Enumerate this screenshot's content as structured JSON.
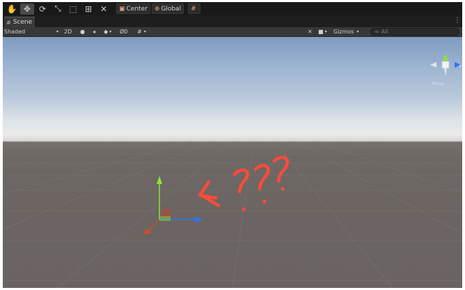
{
  "toolbar": {
    "tools": [
      {
        "name": "hand-tool",
        "icon": "hand-icon",
        "glyph": "✋",
        "active": false
      },
      {
        "name": "move-tool",
        "icon": "move-icon",
        "glyph": "✥",
        "active": true
      },
      {
        "name": "rotate-tool",
        "icon": "rotate-icon",
        "glyph": "⟳",
        "active": false
      },
      {
        "name": "scale-tool",
        "icon": "scale-icon",
        "glyph": "⤡",
        "active": false
      },
      {
        "name": "rect-tool",
        "icon": "rect-tool-icon",
        "glyph": "⬚",
        "active": false
      },
      {
        "name": "transform-tool",
        "icon": "transform-icon",
        "glyph": "⊞",
        "active": false
      },
      {
        "name": "custom-tool",
        "icon": "custom-tool-icon",
        "glyph": "✕",
        "active": false
      }
    ],
    "pivot_label": "Center",
    "space_label": "Global",
    "pivot_icon": "▣",
    "space_icon": "⊕",
    "snap_icon": "#"
  },
  "tab": {
    "label": "Scene",
    "icon": "#",
    "menu": "⋮"
  },
  "scene_bar": {
    "shading": "Shaded",
    "mode_2d": "2D",
    "light_icon": "●",
    "audio_icon": "◂",
    "fx_icon": "◆",
    "hidden_icon": "Ø",
    "hidden_count": "0",
    "grid_icon": "#",
    "tools_icon": "✕",
    "camera_icon": "■",
    "gizmos": "Gizmos",
    "search_placeholder": "All",
    "search_icon": "≈",
    "dropdown_glyph": "▾"
  },
  "viewport": {
    "persp_label": "Persp",
    "annotation_text": "???",
    "colors": {
      "sky_top": "#7e9bc0",
      "horizon": "#ebebea",
      "ground": "#6d6664",
      "gizmo_y": "#8ce32f",
      "gizmo_x": "#2f73ff",
      "gizmo_z": "#d24a2c",
      "annotation": "#ff4b38"
    }
  }
}
